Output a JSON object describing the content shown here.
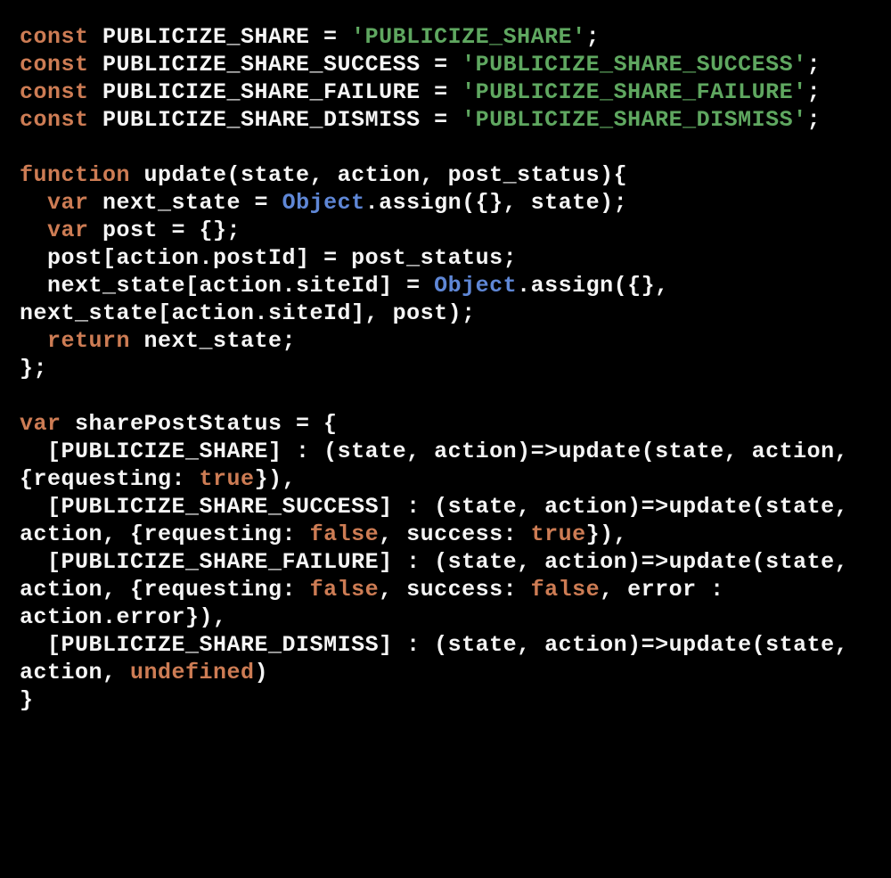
{
  "code": {
    "lines": [
      [
        {
          "cls": "tok-kw",
          "t": "const"
        },
        {
          "cls": "tok-def",
          "t": " PUBLICIZE_SHARE = "
        },
        {
          "cls": "tok-str",
          "t": "'PUBLICIZE_SHARE'"
        },
        {
          "cls": "tok-def",
          "t": ";"
        }
      ],
      [
        {
          "cls": "tok-kw",
          "t": "const"
        },
        {
          "cls": "tok-def",
          "t": " PUBLICIZE_SHARE_SUCCESS = "
        },
        {
          "cls": "tok-str",
          "t": "'PUBLICIZE_SHARE_SUCCESS'"
        },
        {
          "cls": "tok-def",
          "t": ";"
        }
      ],
      [
        {
          "cls": "tok-kw",
          "t": "const"
        },
        {
          "cls": "tok-def",
          "t": " PUBLICIZE_SHARE_FAILURE = "
        },
        {
          "cls": "tok-str",
          "t": "'PUBLICIZE_SHARE_FAILURE'"
        },
        {
          "cls": "tok-def",
          "t": ";"
        }
      ],
      [
        {
          "cls": "tok-kw",
          "t": "const"
        },
        {
          "cls": "tok-def",
          "t": " PUBLICIZE_SHARE_DISMISS = "
        },
        {
          "cls": "tok-str",
          "t": "'PUBLICIZE_SHARE_DISMISS'"
        },
        {
          "cls": "tok-def",
          "t": ";"
        }
      ],
      [],
      [
        {
          "cls": "tok-kw",
          "t": "function"
        },
        {
          "cls": "tok-def",
          "t": " update(state, action, post_status){"
        }
      ],
      [
        {
          "cls": "tok-def",
          "t": "  "
        },
        {
          "cls": "tok-kw",
          "t": "var"
        },
        {
          "cls": "tok-def",
          "t": " next_state = "
        },
        {
          "cls": "tok-obj",
          "t": "Object"
        },
        {
          "cls": "tok-def",
          "t": ".assign({}, state);"
        }
      ],
      [
        {
          "cls": "tok-def",
          "t": "  "
        },
        {
          "cls": "tok-kw",
          "t": "var"
        },
        {
          "cls": "tok-def",
          "t": " post = {};"
        }
      ],
      [
        {
          "cls": "tok-def",
          "t": "  post[action.postId] = post_status;"
        }
      ],
      [
        {
          "cls": "tok-def",
          "t": "  next_state[action.siteId] = "
        },
        {
          "cls": "tok-obj",
          "t": "Object"
        },
        {
          "cls": "tok-def",
          "t": ".assign({}, next_state[action.siteId], post);"
        }
      ],
      [
        {
          "cls": "tok-def",
          "t": "  "
        },
        {
          "cls": "tok-kw",
          "t": "return"
        },
        {
          "cls": "tok-def",
          "t": " next_state;"
        }
      ],
      [
        {
          "cls": "tok-def",
          "t": "};"
        }
      ],
      [],
      [
        {
          "cls": "tok-kw",
          "t": "var"
        },
        {
          "cls": "tok-def",
          "t": " sharePostStatus = {"
        }
      ],
      [
        {
          "cls": "tok-def",
          "t": "  [PUBLICIZE_SHARE] : (state, action)=>update(state, action, {requesting: "
        },
        {
          "cls": "tok-lit",
          "t": "true"
        },
        {
          "cls": "tok-def",
          "t": "}),"
        }
      ],
      [
        {
          "cls": "tok-def",
          "t": "  [PUBLICIZE_SHARE_SUCCESS] : (state, action)=>update(state, action, {requesting: "
        },
        {
          "cls": "tok-lit",
          "t": "false"
        },
        {
          "cls": "tok-def",
          "t": ", success: "
        },
        {
          "cls": "tok-lit",
          "t": "true"
        },
        {
          "cls": "tok-def",
          "t": "}),"
        }
      ],
      [
        {
          "cls": "tok-def",
          "t": "  [PUBLICIZE_SHARE_FAILURE] : (state, action)=>update(state, action, {requesting: "
        },
        {
          "cls": "tok-lit",
          "t": "false"
        },
        {
          "cls": "tok-def",
          "t": ", success: "
        },
        {
          "cls": "tok-lit",
          "t": "false"
        },
        {
          "cls": "tok-def",
          "t": ", error : action.error}),"
        }
      ],
      [
        {
          "cls": "tok-def",
          "t": "  [PUBLICIZE_SHARE_DISMISS] : (state, action)=>update(state, action, "
        },
        {
          "cls": "tok-lit",
          "t": "undefined"
        },
        {
          "cls": "tok-def",
          "t": ")"
        }
      ],
      [
        {
          "cls": "tok-def",
          "t": "}"
        }
      ]
    ]
  }
}
